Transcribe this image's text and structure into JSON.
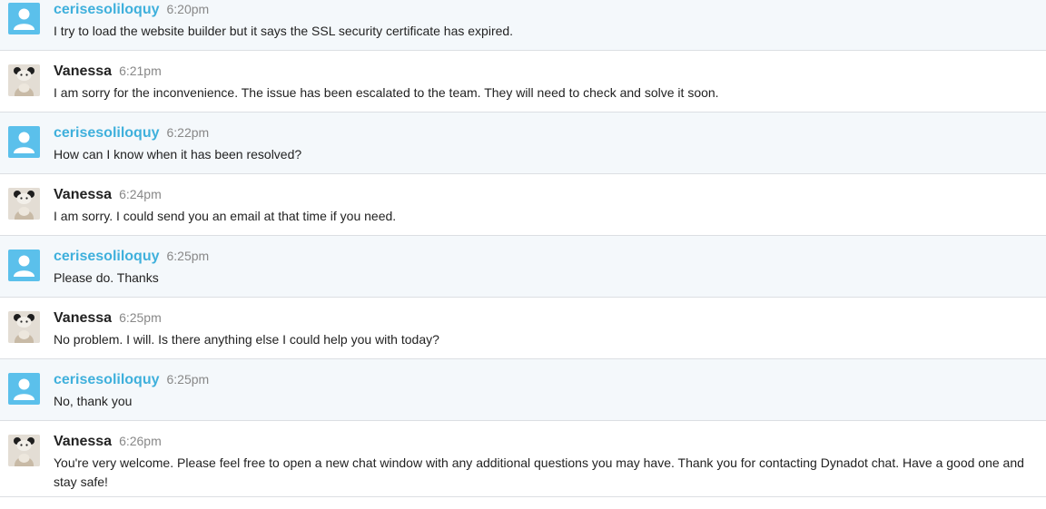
{
  "messages": [
    {
      "role": "customer",
      "name": "cerisesoliloquy",
      "time": "6:20pm",
      "text": "I try to load the website builder but it says the SSL security certificate has expired."
    },
    {
      "role": "agent",
      "name": "Vanessa",
      "time": "6:21pm",
      "text": "I am sorry for the inconvenience. The issue has been escalated to the team. They will need to check and solve it soon."
    },
    {
      "role": "customer",
      "name": "cerisesoliloquy",
      "time": "6:22pm",
      "text": "How can I know when it has been resolved?"
    },
    {
      "role": "agent",
      "name": "Vanessa",
      "time": "6:24pm",
      "text": "I am sorry. I could send you an email at that time if you need."
    },
    {
      "role": "customer",
      "name": "cerisesoliloquy",
      "time": "6:25pm",
      "text": "Please do. Thanks"
    },
    {
      "role": "agent",
      "name": "Vanessa",
      "time": "6:25pm",
      "text": "No problem. I will. Is there anything else I could help you with today?"
    },
    {
      "role": "customer",
      "name": "cerisesoliloquy",
      "time": "6:25pm",
      "text": "No, thank you"
    },
    {
      "role": "agent",
      "name": "Vanessa",
      "time": "6:26pm",
      "text": "You're very welcome.  Please feel free to open a new chat window with any additional questions you may have. Thank you for contacting Dynadot chat. Have a good one and stay safe!"
    }
  ],
  "avatars": {
    "customer": {
      "icon": "user-silhouette-icon",
      "color": "#5bc0eb"
    },
    "agent": {
      "icon": "agent-photo-avatar"
    }
  },
  "colors": {
    "customer_name": "#3fb0dc",
    "agent_name": "#222222",
    "customer_bg": "#f4f8fb",
    "agent_bg": "#ffffff",
    "timestamp": "#888888"
  }
}
